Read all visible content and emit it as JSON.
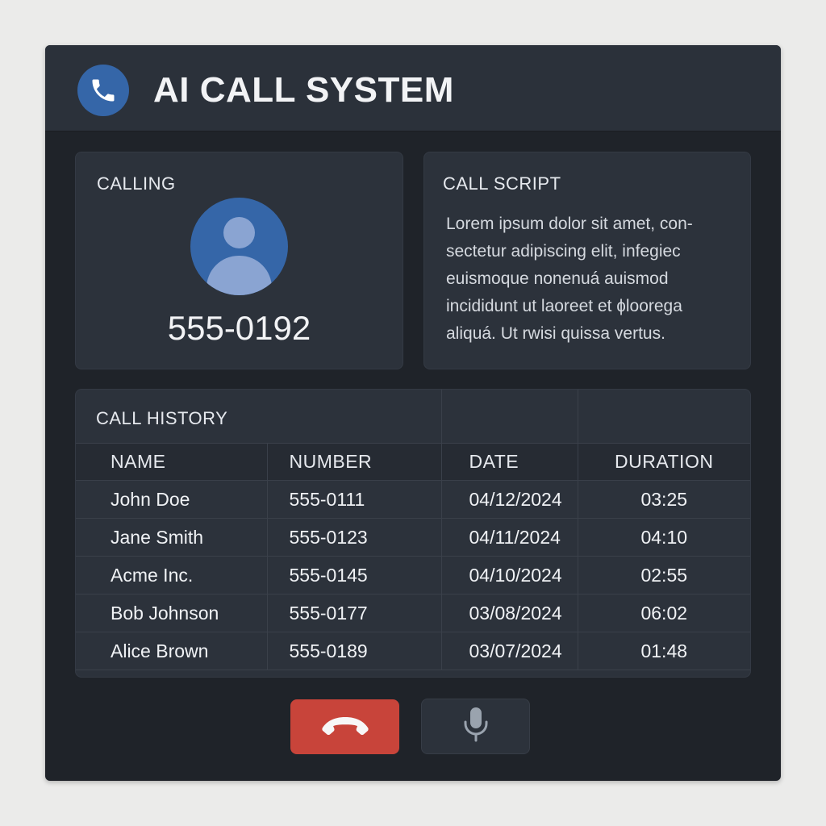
{
  "app": {
    "title": "AI CALL SYSTEM",
    "logo_icon": "phone-icon",
    "accent_color": "#3566a8"
  },
  "calling": {
    "title": "CALLING",
    "number": "555-0192",
    "avatar_icon": "user-avatar-icon"
  },
  "script": {
    "title": "CALL SCRIPT",
    "text": "Lorem ipsum dolor sit amet, con-sectetur adipiscing elit, infegiec euismoque nonenuá auismod incididunt ut laoreet et ɸlooregа aliquá. Ut rwisi quissa vertus."
  },
  "history": {
    "title": "CALL HISTORY",
    "columns": [
      "NAME",
      "NUMBER",
      "DATE",
      "DURATION"
    ],
    "rows": [
      {
        "name": "John Doe",
        "number": "555-0111",
        "date": "04/12/2024",
        "duration": "03:25"
      },
      {
        "name": "Jane Smith",
        "number": "555-0123",
        "date": "04/11/2024",
        "duration": "04:10"
      },
      {
        "name": "Acme Inc.",
        "number": "555-0145",
        "date": "04/10/2024",
        "duration": "02:55"
      },
      {
        "name": "Bob Johnson",
        "number": "555-0177",
        "date": "03/08/2024",
        "duration": "06:02"
      },
      {
        "name": "Alice Brown",
        "number": "555-0189",
        "date": "03/07/2024",
        "duration": "01:48"
      }
    ]
  },
  "controls": {
    "hangup_icon": "hang-up-icon",
    "hangup_color": "#c8443a",
    "mic_icon": "microphone-icon"
  }
}
